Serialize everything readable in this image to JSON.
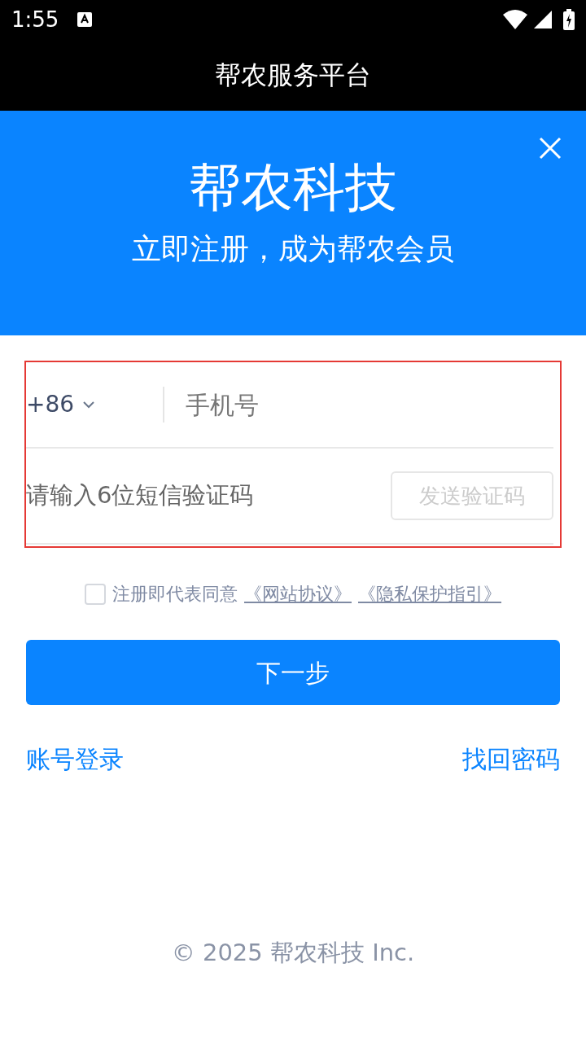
{
  "status_bar": {
    "time": "1:55"
  },
  "app_bar": {
    "title": "帮农服务平台"
  },
  "banner": {
    "title": "帮农科技",
    "subtitle": "立即注册，成为帮农会员"
  },
  "form": {
    "highlighted": true,
    "country_code": "+86",
    "phone_placeholder": "手机号",
    "code_placeholder": "请输入6位短信验证码",
    "send_code_button": {
      "label": "发送验证码",
      "disabled": true
    }
  },
  "agreement": {
    "checked": false,
    "text": "注册即代表同意",
    "links": [
      "《网站协议》",
      "《隐私保护指引》"
    ]
  },
  "next_button": "下一步",
  "links": {
    "left": "账号登录",
    "right": "找回密码"
  },
  "footer": "© 2025 帮农科技 Inc."
}
